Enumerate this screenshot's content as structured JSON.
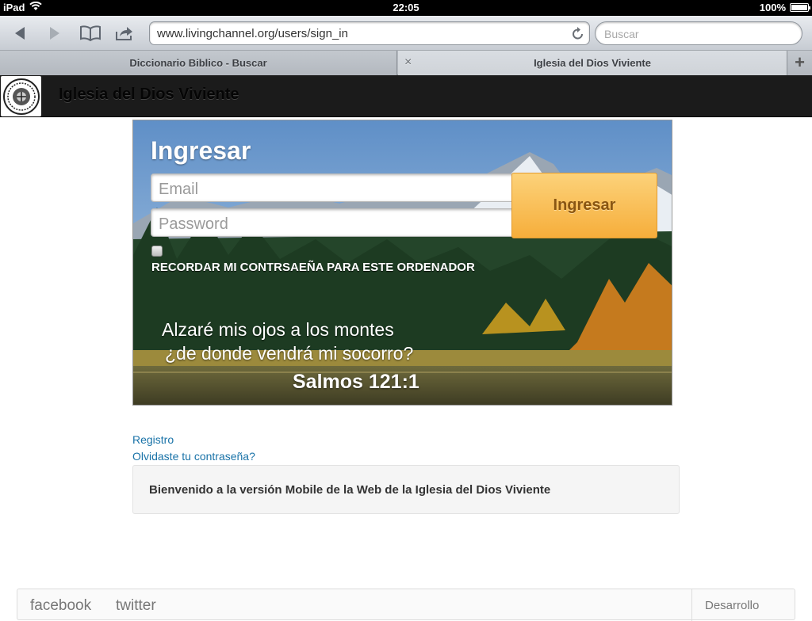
{
  "status": {
    "device": "iPad",
    "time": "22:05",
    "battery": "100%"
  },
  "browser": {
    "url": "www.livingchannel.org/users/sign_in",
    "search_placeholder": "Buscar",
    "tabs": [
      {
        "label": "Diccionario Biblico - Buscar"
      },
      {
        "label": "Iglesia del Dios Viviente"
      }
    ],
    "tab_close": "×",
    "new_tab": "+"
  },
  "site": {
    "title": "Iglesia del Dios Viviente"
  },
  "login": {
    "title": "Ingresar",
    "email_placeholder": "Email",
    "password_placeholder": "Password",
    "button": "Ingresar",
    "remember_label": "RECORDAR MI CONTRSAEÑA PARA ESTE ORDENADOR"
  },
  "verse": {
    "line1": "Alzaré mis ojos a los montes",
    "line2": "¿de donde vendrá mi socorro?",
    "reference": "Salmos 121:1"
  },
  "links": {
    "register": "Registro",
    "forgot": "Olvidaste tu contraseña?"
  },
  "welcome": "Bienvenido a la versión Mobile de la Web de la Iglesia del Dios Viviente",
  "footer": {
    "facebook": "facebook",
    "twitter": "twitter",
    "right": "Desarrollo"
  },
  "colors": {
    "accent_button": "#f6ae3b",
    "link": "#1a73a8",
    "header": "#1b1b1b"
  }
}
